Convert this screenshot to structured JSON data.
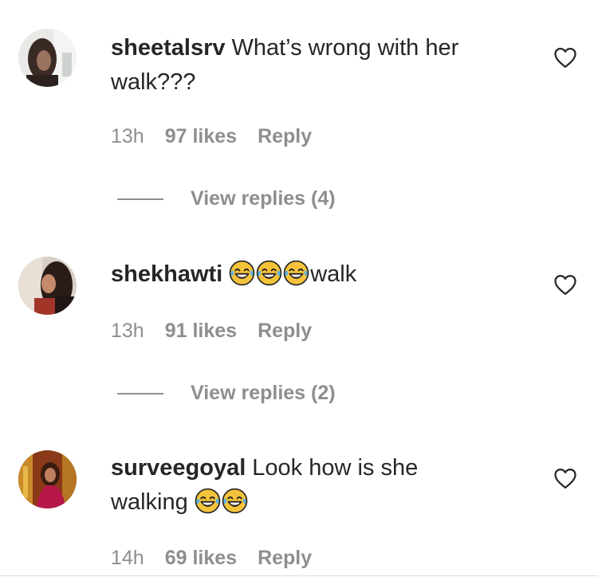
{
  "comments": [
    {
      "username": "sheetalsrv",
      "text": "What’s wrong with her",
      "text2": "walk???",
      "time": "13h",
      "likes": "97 likes",
      "reply": "Reply",
      "view_replies": "View replies (4)",
      "avatar_icon": "user-avatar-photo",
      "like_icon": "heart-outline-icon"
    },
    {
      "username": "shekhawti",
      "emojis": [
        "face-with-tears-of-joy",
        "face-with-tears-of-joy",
        "face-with-tears-of-joy"
      ],
      "text": "walk",
      "time": "13h",
      "likes": "91 likes",
      "reply": "Reply",
      "view_replies": "View replies (2)",
      "avatar_icon": "user-avatar-photo",
      "like_icon": "heart-outline-icon"
    },
    {
      "username": "surveegoyal",
      "text": "Look how is she",
      "text2": "walking",
      "emojis": [
        "face-with-tears-of-joy",
        "face-with-tears-of-joy"
      ],
      "time": "14h",
      "likes": "69 likes",
      "reply": "Reply",
      "avatar_icon": "user-avatar-photo",
      "like_icon": "heart-outline-icon"
    }
  ],
  "colors": {
    "primary_text": "#262626",
    "secondary_text": "#8e8e8e",
    "emoji_face": "#f5c33b",
    "emoji_tears": "#5ab4e8"
  }
}
